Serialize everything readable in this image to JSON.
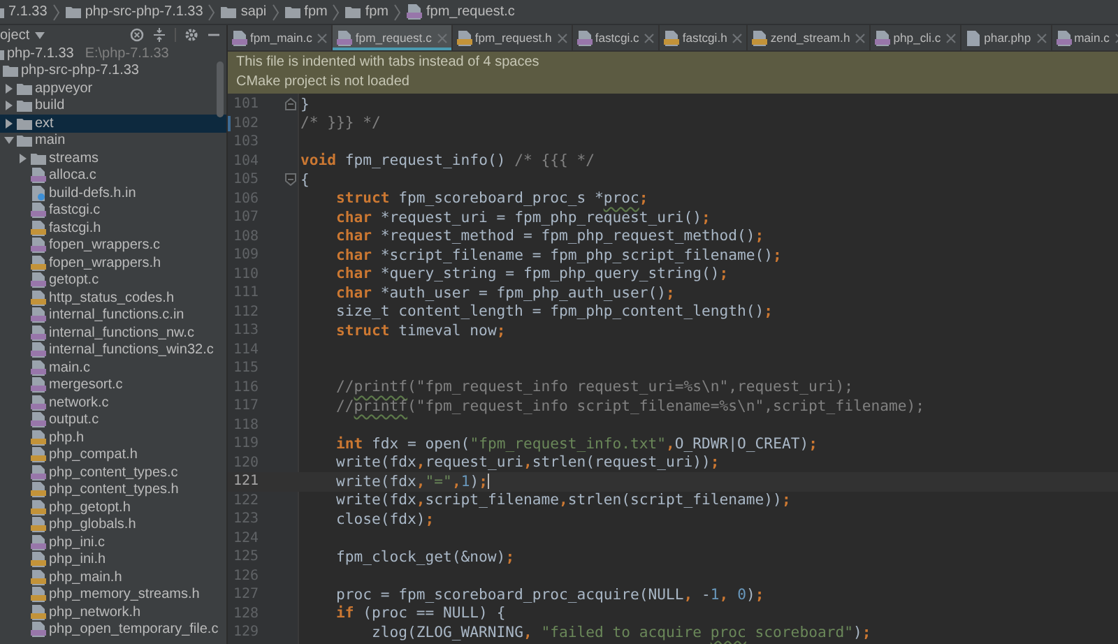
{
  "breadcrumb": [
    {
      "label": "7.1.33",
      "kind": "folder"
    },
    {
      "label": "php-src-php-7.1.33",
      "kind": "folder"
    },
    {
      "label": "sapi",
      "kind": "folder"
    },
    {
      "label": "fpm",
      "kind": "folder"
    },
    {
      "label": "fpm",
      "kind": "folder"
    },
    {
      "label": "fpm_request.c",
      "kind": "c"
    }
  ],
  "project_panel": {
    "title": "oject"
  },
  "tree": {
    "items": [
      {
        "label": "php-7.1.33",
        "path": "E:\\php-7.1.33",
        "kind": "folder",
        "selected": false,
        "children": [
          {
            "label": "php-src-php-7.1.33",
            "kind": "folder",
            "expanded": true,
            "selected": false,
            "children": [
              {
                "label": "appveyor",
                "kind": "folder",
                "expanded": false,
                "selected": false
              },
              {
                "label": "build",
                "kind": "folder",
                "expanded": false,
                "selected": false
              },
              {
                "label": "ext",
                "kind": "folder",
                "expanded": false,
                "selected": true
              },
              {
                "label": "main",
                "kind": "folder",
                "expanded": true,
                "selected": false,
                "children": [
                  {
                    "label": "streams",
                    "kind": "folder",
                    "expanded": false,
                    "selected": false
                  },
                  {
                    "label": "alloca.c",
                    "kind": "c",
                    "selected": false
                  },
                  {
                    "label": "build-defs.h.in",
                    "kind": "other",
                    "selected": false
                  },
                  {
                    "label": "fastcgi.c",
                    "kind": "c",
                    "selected": false
                  },
                  {
                    "label": "fastcgi.h",
                    "kind": "h",
                    "selected": false
                  },
                  {
                    "label": "fopen_wrappers.c",
                    "kind": "c",
                    "selected": false
                  },
                  {
                    "label": "fopen_wrappers.h",
                    "kind": "h",
                    "selected": false
                  },
                  {
                    "label": "getopt.c",
                    "kind": "c",
                    "selected": false
                  },
                  {
                    "label": "http_status_codes.h",
                    "kind": "h",
                    "selected": false
                  },
                  {
                    "label": "internal_functions.c.in",
                    "kind": "c",
                    "selected": false
                  },
                  {
                    "label": "internal_functions_nw.c",
                    "kind": "c",
                    "selected": false
                  },
                  {
                    "label": "internal_functions_win32.c",
                    "kind": "c",
                    "selected": false
                  },
                  {
                    "label": "main.c",
                    "kind": "c",
                    "selected": false
                  },
                  {
                    "label": "mergesort.c",
                    "kind": "c",
                    "selected": false
                  },
                  {
                    "label": "network.c",
                    "kind": "c",
                    "selected": false
                  },
                  {
                    "label": "output.c",
                    "kind": "c",
                    "selected": false
                  },
                  {
                    "label": "php.h",
                    "kind": "h",
                    "selected": false
                  },
                  {
                    "label": "php_compat.h",
                    "kind": "h",
                    "selected": false
                  },
                  {
                    "label": "php_content_types.c",
                    "kind": "c",
                    "selected": false
                  },
                  {
                    "label": "php_content_types.h",
                    "kind": "h",
                    "selected": false
                  },
                  {
                    "label": "php_getopt.h",
                    "kind": "h",
                    "selected": false
                  },
                  {
                    "label": "php_globals.h",
                    "kind": "h",
                    "selected": false
                  },
                  {
                    "label": "php_ini.c",
                    "kind": "c",
                    "selected": false
                  },
                  {
                    "label": "php_ini.h",
                    "kind": "h",
                    "selected": false
                  },
                  {
                    "label": "php_main.h",
                    "kind": "h",
                    "selected": false
                  },
                  {
                    "label": "php_memory_streams.h",
                    "kind": "h",
                    "selected": false
                  },
                  {
                    "label": "php_network.h",
                    "kind": "h",
                    "selected": false
                  },
                  {
                    "label": "php_open_temporary_file.c",
                    "kind": "c",
                    "selected": false
                  }
                ]
              }
            ]
          }
        ]
      }
    ]
  },
  "tabs": [
    {
      "label": "fpm_main.c",
      "kind": "c",
      "selected": false
    },
    {
      "label": "fpm_request.c",
      "kind": "c",
      "selected": true
    },
    {
      "label": "fpm_request.h",
      "kind": "h",
      "selected": false
    },
    {
      "label": "fastcgi.c",
      "kind": "c",
      "selected": false
    },
    {
      "label": "fastcgi.h",
      "kind": "h",
      "selected": false
    },
    {
      "label": "zend_stream.h",
      "kind": "h",
      "selected": false
    },
    {
      "label": "php_cli.c",
      "kind": "c",
      "selected": false
    },
    {
      "label": "phar.php",
      "kind": "php",
      "selected": false
    },
    {
      "label": "main.c",
      "kind": "c",
      "selected": false
    }
  ],
  "notifications": [
    "This file is indented with tabs instead of 4 spaces",
    "CMake project is not loaded"
  ],
  "code": {
    "lines": [
      {
        "number": "101",
        "kind": "top",
        "fold": {
          "kind": "end"
        },
        "current": false,
        "modified": false,
        "tokens": [
          {
            "kind": "plain",
            "text": "}"
          }
        ]
      },
      {
        "number": "102",
        "kind": "top",
        "current": false,
        "modified": true,
        "tokens": [
          {
            "kind": "comment",
            "text": "/* }}} */"
          }
        ]
      },
      {
        "number": "103",
        "current": false,
        "modified": false
      },
      {
        "number": "104",
        "kind": "top",
        "current": false,
        "modified": false,
        "tokens": [
          {
            "kind": "keyword",
            "text": "void"
          },
          {
            "kind": "plain",
            "text": " fpm_request_info() "
          },
          {
            "kind": "comment",
            "text": "/* {{{ */"
          }
        ]
      },
      {
        "number": "105",
        "kind": "top",
        "fold": {
          "kind": "start"
        },
        "current": false,
        "modified": false,
        "tokens": [
          {
            "kind": "plain",
            "text": "{"
          }
        ]
      },
      {
        "number": "106",
        "kind": "body",
        "current": false,
        "modified": false,
        "tokens": [
          {
            "kind": "keyword",
            "text": "struct"
          },
          {
            "kind": "plain",
            "text": " fpm_scoreboard_proc_s *"
          },
          {
            "kind": "plain_flag",
            "text": "proc"
          },
          {
            "kind": "punct",
            "text": ";"
          }
        ]
      },
      {
        "number": "107",
        "kind": "body",
        "current": false,
        "modified": false,
        "tokens": [
          {
            "kind": "keyword",
            "text": "char"
          },
          {
            "kind": "plain",
            "text": " *request_uri = fpm_php_request_uri()"
          },
          {
            "kind": "punct",
            "text": ";"
          }
        ]
      },
      {
        "number": "108",
        "kind": "body",
        "current": false,
        "modified": false,
        "tokens": [
          {
            "kind": "keyword",
            "text": "char"
          },
          {
            "kind": "plain",
            "text": " *request_method = fpm_php_request_method()"
          },
          {
            "kind": "punct",
            "text": ";"
          }
        ]
      },
      {
        "number": "109",
        "kind": "body",
        "current": false,
        "modified": false,
        "tokens": [
          {
            "kind": "keyword",
            "text": "char"
          },
          {
            "kind": "plain",
            "text": " *script_filename = fpm_php_script_filename()"
          },
          {
            "kind": "punct",
            "text": ";"
          }
        ]
      },
      {
        "number": "110",
        "kind": "body",
        "current": false,
        "modified": false,
        "tokens": [
          {
            "kind": "keyword",
            "text": "char"
          },
          {
            "kind": "plain",
            "text": " *query_string = fpm_php_query_string()"
          },
          {
            "kind": "punct",
            "text": ";"
          }
        ]
      },
      {
        "number": "111",
        "kind": "body",
        "current": false,
        "modified": false,
        "tokens": [
          {
            "kind": "keyword",
            "text": "char"
          },
          {
            "kind": "plain",
            "text": " *auth_user = fpm_php_auth_user()"
          },
          {
            "kind": "punct",
            "text": ";"
          }
        ]
      },
      {
        "number": "112",
        "kind": "body",
        "current": false,
        "modified": false,
        "tokens": [
          {
            "kind": "plain",
            "text": "size_t content_length = fpm_php_content_length()"
          },
          {
            "kind": "punct",
            "text": ";"
          }
        ]
      },
      {
        "number": "113",
        "kind": "body",
        "current": false,
        "modified": false,
        "tokens": [
          {
            "kind": "keyword",
            "text": "struct"
          },
          {
            "kind": "plain",
            "text": " timeval now"
          },
          {
            "kind": "punct",
            "text": ";"
          }
        ]
      },
      {
        "number": "114",
        "current": false,
        "modified": false
      },
      {
        "number": "115",
        "current": false,
        "modified": false
      },
      {
        "number": "116",
        "kind": "body",
        "current": false,
        "modified": false,
        "tokens": [
          {
            "kind": "comment",
            "text": "//"
          },
          {
            "kind": "comment_flag",
            "text": "printf"
          },
          {
            "kind": "comment",
            "text": "(\"fpm_request_info request_uri=%s\\n\",request_uri);"
          }
        ]
      },
      {
        "number": "117",
        "kind": "body",
        "current": false,
        "modified": false,
        "tokens": [
          {
            "kind": "comment",
            "text": "//"
          },
          {
            "kind": "comment_flag",
            "text": "printf"
          },
          {
            "kind": "comment",
            "text": "(\"fpm_request_info script_filename=%s\\n\",script_filename);"
          }
        ]
      },
      {
        "number": "118",
        "current": false,
        "modified": false
      },
      {
        "number": "119",
        "kind": "body",
        "current": false,
        "modified": false,
        "tokens": [
          {
            "kind": "keyword",
            "text": "int"
          },
          {
            "kind": "plain",
            "text": " fdx = open("
          },
          {
            "kind": "string",
            "text": "\"fpm_request_info.txt\""
          },
          {
            "kind": "punct",
            "text": ","
          },
          {
            "kind": "plain",
            "text": "O_RDWR|O_CREAT)"
          },
          {
            "kind": "punct",
            "text": ";"
          }
        ]
      },
      {
        "number": "120",
        "kind": "body",
        "current": false,
        "modified": false,
        "tokens": [
          {
            "kind": "plain",
            "text": "write(fdx"
          },
          {
            "kind": "punct",
            "text": ","
          },
          {
            "kind": "plain",
            "text": "request_uri"
          },
          {
            "kind": "punct",
            "text": ","
          },
          {
            "kind": "plain",
            "text": "strlen(request_uri))"
          },
          {
            "kind": "punct",
            "text": ";"
          }
        ]
      },
      {
        "number": "121",
        "kind": "body",
        "current": true,
        "modified": false,
        "tokens": [
          {
            "kind": "plain",
            "text": "write(fdx"
          },
          {
            "kind": "punct",
            "text": ","
          },
          {
            "kind": "string",
            "text": "\"=\""
          },
          {
            "kind": "punct",
            "text": ","
          },
          {
            "kind": "number",
            "text": "1"
          },
          {
            "kind": "plain",
            "text": ")"
          },
          {
            "kind": "punct",
            "text": ";"
          }
        ]
      },
      {
        "number": "122",
        "kind": "body",
        "current": false,
        "modified": false,
        "tokens": [
          {
            "kind": "plain",
            "text": "write(fdx"
          },
          {
            "kind": "punct",
            "text": ","
          },
          {
            "kind": "plain",
            "text": "script_filename"
          },
          {
            "kind": "punct",
            "text": ","
          },
          {
            "kind": "plain",
            "text": "strlen(script_filename))"
          },
          {
            "kind": "punct",
            "text": ";"
          }
        ]
      },
      {
        "number": "123",
        "kind": "body",
        "current": false,
        "modified": false,
        "tokens": [
          {
            "kind": "plain",
            "text": "close(fdx)"
          },
          {
            "kind": "punct",
            "text": ";"
          }
        ]
      },
      {
        "number": "124",
        "current": false,
        "modified": false
      },
      {
        "number": "125",
        "kind": "body",
        "current": false,
        "modified": false,
        "tokens": [
          {
            "kind": "plain",
            "text": "fpm_clock_get(&now)"
          },
          {
            "kind": "punct",
            "text": ";"
          }
        ]
      },
      {
        "number": "126",
        "current": false,
        "modified": false
      },
      {
        "number": "127",
        "kind": "body",
        "current": false,
        "modified": false,
        "tokens": [
          {
            "kind": "plain",
            "text": "proc = fpm_scoreboard_proc_acquire(NULL"
          },
          {
            "kind": "punct",
            "text": ", "
          },
          {
            "kind": "plain",
            "text": "-"
          },
          {
            "kind": "number",
            "text": "1"
          },
          {
            "kind": "punct",
            "text": ", "
          },
          {
            "kind": "number",
            "text": "0"
          },
          {
            "kind": "plain",
            "text": ")"
          },
          {
            "kind": "punct",
            "text": ";"
          }
        ]
      },
      {
        "number": "128",
        "kind": "body",
        "current": false,
        "modified": false,
        "tokens": [
          {
            "kind": "keyword",
            "text": "if"
          },
          {
            "kind": "plain",
            "text": " (proc == NULL) {"
          }
        ]
      },
      {
        "number": "129",
        "kind": "nested",
        "current": false,
        "modified": false,
        "tokens": [
          {
            "kind": "plain",
            "text": "zlog(ZLOG_WARNING"
          },
          {
            "kind": "punct",
            "text": ", "
          },
          {
            "kind": "string",
            "text": "\"failed to acquire "
          },
          {
            "kind": "string_flag",
            "text": "proc"
          },
          {
            "kind": "string",
            "text": " scoreboard\""
          },
          {
            "kind": "plain",
            "text": ")"
          },
          {
            "kind": "punct",
            "text": ";"
          }
        ]
      }
    ]
  }
}
